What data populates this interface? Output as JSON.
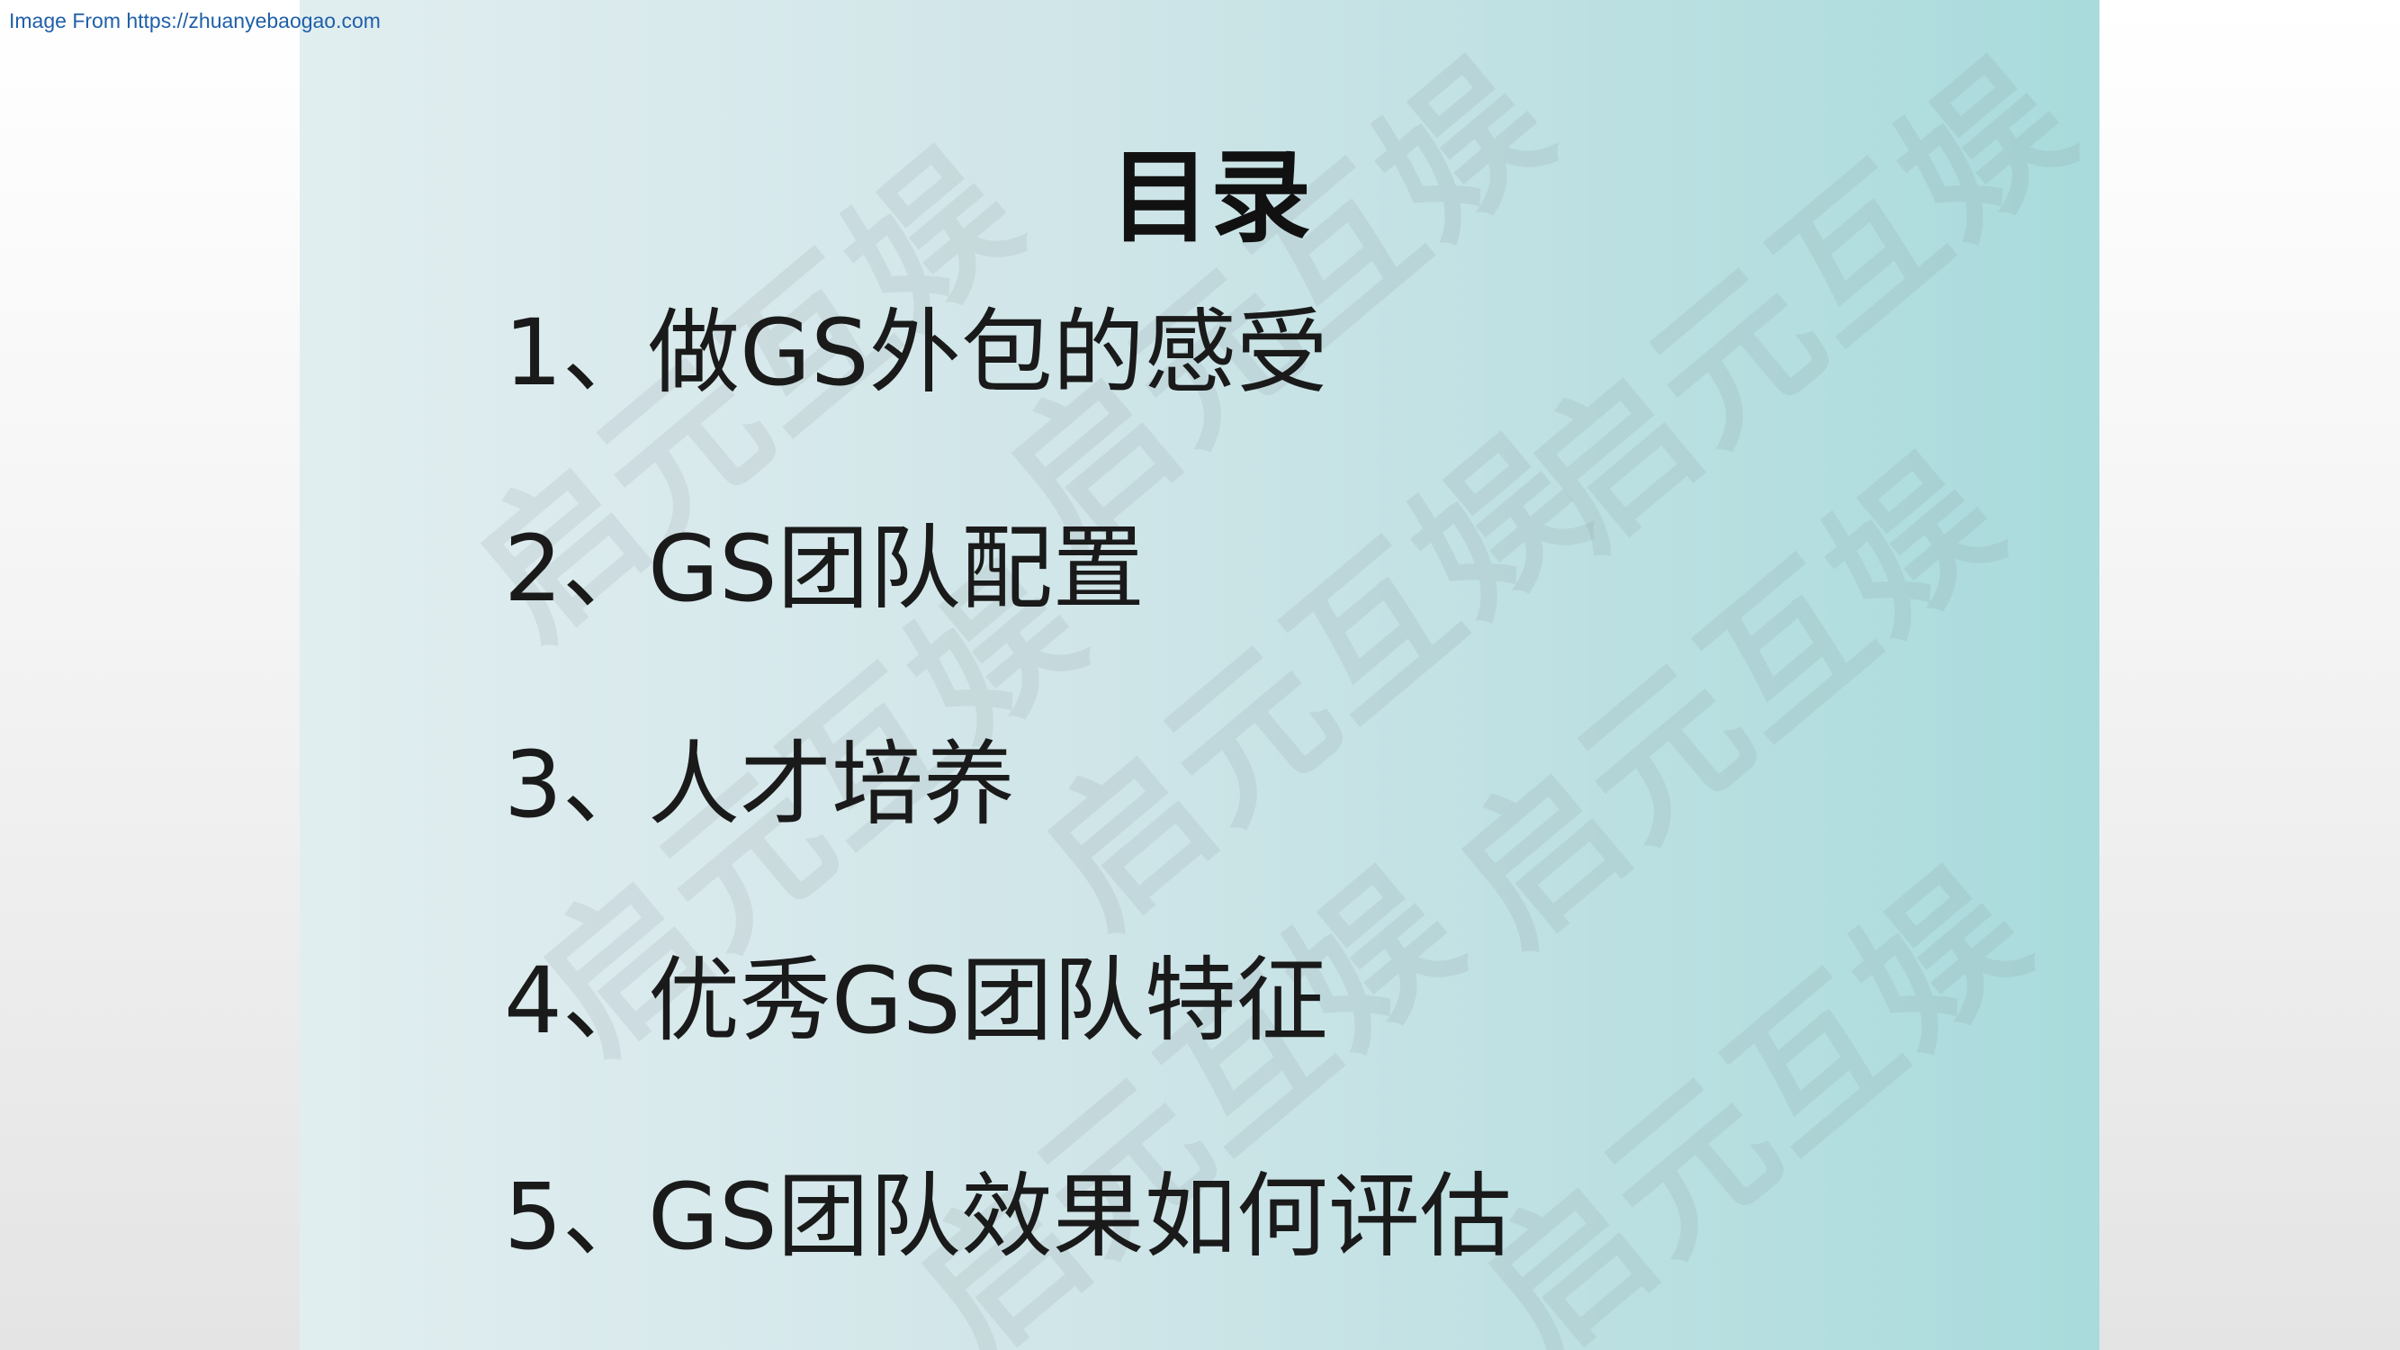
{
  "source_note": "Image From https://zhuanyebaogao.com",
  "slide": {
    "title": "目录",
    "watermark_text": "启元互娱",
    "items": [
      {
        "number": "1、",
        "text": "做GS外包的感受"
      },
      {
        "number": "2、",
        "text": "GS团队配置"
      },
      {
        "number": "3、",
        "text": "人才培养"
      },
      {
        "number": "4、",
        "text": "优秀GS团队特征"
      },
      {
        "number": "5、",
        "text": "GS团队效果如何评估"
      }
    ]
  },
  "colors": {
    "page_background": "#f4f4f4",
    "slide_gradient_start": "#e1eef0",
    "slide_gradient_end": "#a9dbdc",
    "text": "#1a1a1a",
    "link": "#1f5fa8"
  }
}
